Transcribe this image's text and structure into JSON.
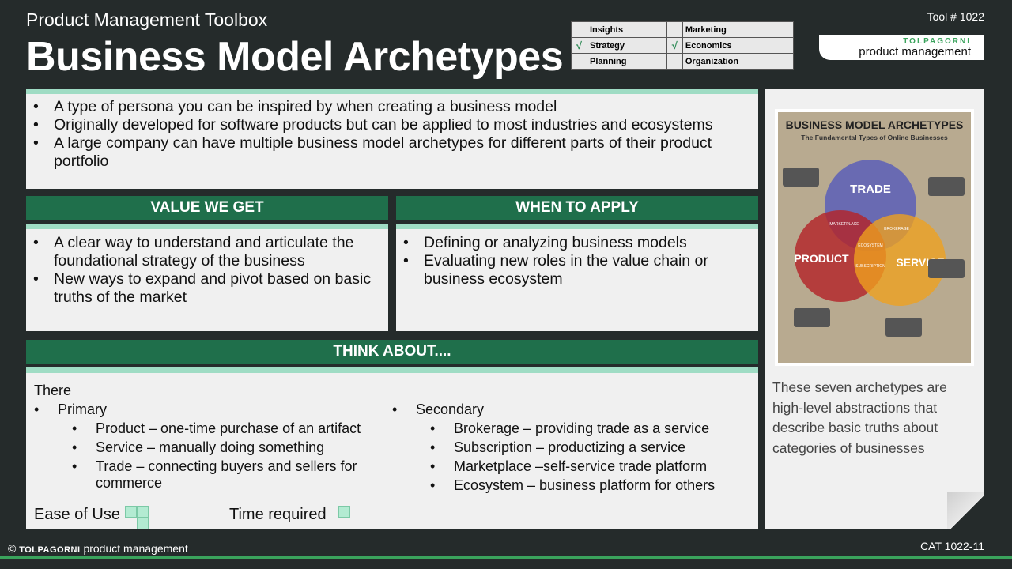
{
  "header": {
    "toolbox": "Product Management Toolbox",
    "title": "Business Model Archetypes",
    "tool_number": "Tool # 1022"
  },
  "categories": [
    {
      "label": "Insights",
      "checked": false
    },
    {
      "label": "Marketing",
      "checked": false
    },
    {
      "label": "Strategy",
      "checked": true
    },
    {
      "label": "Economics",
      "checked": true
    },
    {
      "label": "Planning",
      "checked": false
    },
    {
      "label": "Organization",
      "checked": false
    }
  ],
  "check_mark": "√",
  "brand": {
    "name": "TOLPAGORNI",
    "tagline": "product management"
  },
  "intro": [
    "A type of persona you can be inspired by when creating a business model",
    "Originally developed for software products but can be applied to most industries and ecosystems",
    "A large company can have multiple business model archetypes for different parts of their product portfolio"
  ],
  "value": {
    "heading": "VALUE WE GET",
    "items": [
      "A clear way to understand and articulate the foundational strategy of the business",
      "New ways to expand and pivot based on basic truths of the market"
    ]
  },
  "when": {
    "heading": "WHEN TO APPLY",
    "items": [
      "Defining or analyzing business models",
      "Evaluating new roles in the value chain or business ecosystem"
    ]
  },
  "think": {
    "heading": "THINK ABOUT....",
    "intro": "There",
    "primary": {
      "label": "Primary",
      "items": [
        "Product – one-time purchase of an artifact",
        "Service – manually doing something",
        "Trade – connecting buyers and sellers for commerce"
      ]
    },
    "secondary": {
      "label": "Secondary",
      "items": [
        "Brokerage – providing trade as a service",
        "Subscription – productizing a service",
        "Marketplace –self-service trade platform",
        "Ecosystem – business platform for others"
      ]
    },
    "ease_label": "Ease of Use",
    "time_label": "Time required"
  },
  "poster": {
    "title": "BUSINESS MODEL ARCHETYPES",
    "subtitle": "The Fundamental Types of Online Businesses",
    "circles": {
      "trade": "TRADE",
      "product": "PRODUCT",
      "service": "SERVICE"
    },
    "overlaps": {
      "marketplace": "MARKETPLACE",
      "brokerage": "BROKERAGE",
      "ecosystem": "ECOSYSTEM",
      "subscription": "SUBSCRIPTION"
    },
    "colors": {
      "trade": "#5a5fb8",
      "product": "#b3242a",
      "service": "#f0a11e"
    }
  },
  "side_text": "These seven archetypes are high-level abstractions that describe basic truths about categories of businesses",
  "footer": {
    "copyright": "©",
    "brand": "TOLPAGORNI",
    "tagline": "product management",
    "code": "CAT 1022-11"
  }
}
